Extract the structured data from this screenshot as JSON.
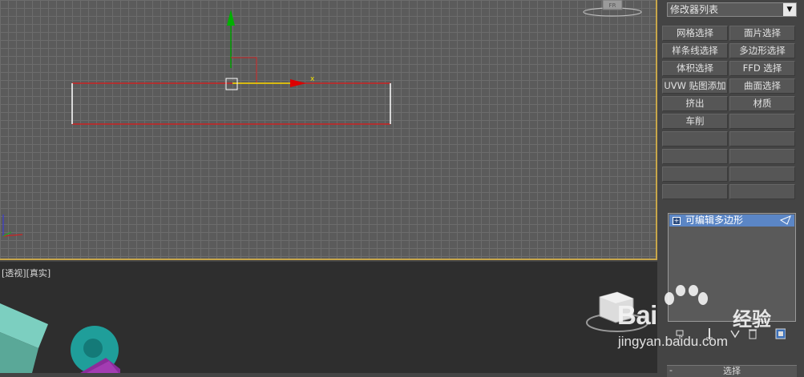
{
  "command_panel": {
    "modifier_list_label": "修改器列表",
    "buttons": [
      {
        "label": "网格选择"
      },
      {
        "label": "面片选择"
      },
      {
        "label": "样条线选择"
      },
      {
        "label": "多边形选择"
      },
      {
        "label": "体积选择"
      },
      {
        "label": "FFD 选择"
      },
      {
        "label": "UVW 贴图添加"
      },
      {
        "label": "曲面选择"
      },
      {
        "label": "挤出"
      },
      {
        "label": "材质"
      },
      {
        "label": "车削"
      },
      {
        "label": ""
      },
      {
        "label": ""
      },
      {
        "label": ""
      },
      {
        "label": ""
      },
      {
        "label": ""
      },
      {
        "label": ""
      },
      {
        "label": ""
      },
      {
        "label": ""
      },
      {
        "label": ""
      }
    ],
    "stack": {
      "items": [
        {
          "label": "可编辑多边形"
        }
      ]
    },
    "rollout_title": "选择"
  },
  "viewports": {
    "top": {
      "gizmo_x_label": "x"
    },
    "bottom": {
      "label": "[透视][真实]"
    }
  },
  "watermark": {
    "brand": "Bai",
    "brand_suffix": "经验",
    "url": "jingyan.baidu.com"
  },
  "colors": {
    "accent_border": "#c8a64a",
    "selection_blue": "#5b86c6",
    "axis_red": "#cc0000",
    "axis_green": "#00a000",
    "axis_yellow": "#f0e000"
  }
}
